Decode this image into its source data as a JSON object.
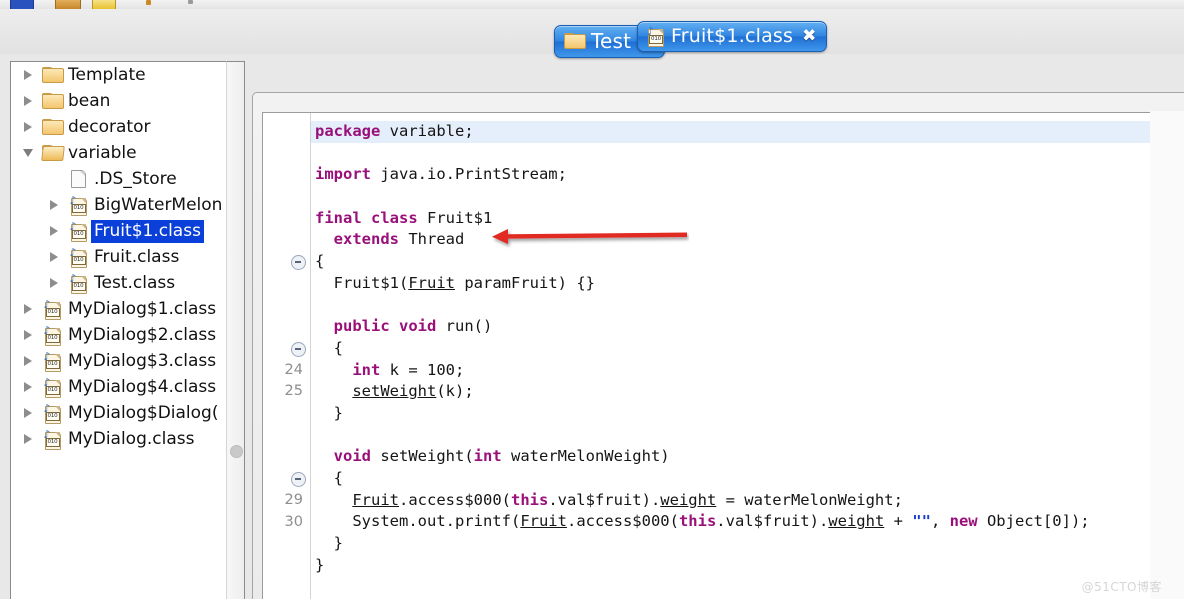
{
  "toolbar": {
    "icons": [
      "blue-button-icon",
      "folder-icon",
      "open-folder-icon",
      "small-dot-icon",
      "small-grey-dot-icon"
    ]
  },
  "project_tabs": [
    {
      "label": "Test",
      "icon": "folder-icon",
      "close_label": "✖",
      "active": true
    }
  ],
  "editor_tabs": [
    {
      "label": "Fruit$1.class",
      "icon": "class-file-icon",
      "close_label": "✖",
      "active": true
    }
  ],
  "sidebar": {
    "items": [
      {
        "label": "Template",
        "icon": "folder-icon",
        "twisty": "right",
        "indent": 0,
        "selected": false
      },
      {
        "label": "bean",
        "icon": "folder-icon",
        "twisty": "right",
        "indent": 0,
        "selected": false
      },
      {
        "label": "decorator",
        "icon": "folder-icon",
        "twisty": "right",
        "indent": 0,
        "selected": false
      },
      {
        "label": "variable",
        "icon": "open-folder-icon",
        "twisty": "down",
        "indent": 0,
        "selected": false
      },
      {
        "label": ".DS_Store",
        "icon": "document-icon",
        "twisty": "none",
        "indent": 1,
        "selected": false
      },
      {
        "label": "BigWaterMelon",
        "icon": "class-file-icon",
        "twisty": "right",
        "indent": 1,
        "selected": false
      },
      {
        "label": "Fruit$1.class",
        "icon": "class-file-icon",
        "twisty": "right",
        "indent": 1,
        "selected": true
      },
      {
        "label": "Fruit.class",
        "icon": "class-file-icon",
        "twisty": "right",
        "indent": 1,
        "selected": false
      },
      {
        "label": "Test.class",
        "icon": "class-file-icon",
        "twisty": "right",
        "indent": 1,
        "selected": false
      },
      {
        "label": "MyDialog$1.class",
        "icon": "class-file-icon",
        "twisty": "right",
        "indent": 0,
        "selected": false
      },
      {
        "label": "MyDialog$2.class",
        "icon": "class-file-icon",
        "twisty": "right",
        "indent": 0,
        "selected": false
      },
      {
        "label": "MyDialog$3.class",
        "icon": "class-file-icon",
        "twisty": "right",
        "indent": 0,
        "selected": false
      },
      {
        "label": "MyDialog$4.class",
        "icon": "class-file-icon",
        "twisty": "right",
        "indent": 0,
        "selected": false
      },
      {
        "label": "MyDialog$Dialog(",
        "icon": "class-file-icon",
        "twisty": "right",
        "indent": 0,
        "selected": false
      },
      {
        "label": "MyDialog.class",
        "icon": "class-file-icon",
        "twisty": "right",
        "indent": 0,
        "selected": false
      }
    ],
    "scrollbar_grip": "scrollbar-grip"
  },
  "editor": {
    "language": "java",
    "lines": [
      {
        "num": "",
        "fold": false,
        "highlight": true,
        "tokens": [
          {
            "t": "package",
            "c": "kw"
          },
          {
            "t": " variable;",
            "c": ""
          }
        ]
      },
      {
        "num": "",
        "fold": false,
        "highlight": false,
        "tokens": []
      },
      {
        "num": "",
        "fold": false,
        "highlight": false,
        "tokens": [
          {
            "t": "import",
            "c": "kw"
          },
          {
            "t": " java.io.PrintStream;",
            "c": ""
          }
        ]
      },
      {
        "num": "",
        "fold": false,
        "highlight": false,
        "tokens": []
      },
      {
        "num": "",
        "fold": false,
        "highlight": false,
        "tokens": [
          {
            "t": "final",
            "c": "kw"
          },
          {
            "t": " ",
            "c": ""
          },
          {
            "t": "class",
            "c": "kw"
          },
          {
            "t": " Fruit$1",
            "c": ""
          }
        ]
      },
      {
        "num": "",
        "fold": false,
        "highlight": false,
        "tokens": [
          {
            "t": "  ",
            "c": ""
          },
          {
            "t": "extends",
            "c": "kw"
          },
          {
            "t": " Thread",
            "c": ""
          }
        ]
      },
      {
        "num": "",
        "fold": true,
        "highlight": false,
        "tokens": [
          {
            "t": "{",
            "c": ""
          }
        ]
      },
      {
        "num": "",
        "fold": false,
        "highlight": false,
        "tokens": [
          {
            "t": "  Fruit$1(",
            "c": ""
          },
          {
            "t": "Fruit",
            "c": "ul"
          },
          {
            "t": " paramFruit) {}",
            "c": ""
          }
        ]
      },
      {
        "num": "",
        "fold": false,
        "highlight": false,
        "tokens": []
      },
      {
        "num": "",
        "fold": false,
        "highlight": false,
        "tokens": [
          {
            "t": "  ",
            "c": ""
          },
          {
            "t": "public",
            "c": "kw"
          },
          {
            "t": " ",
            "c": ""
          },
          {
            "t": "void",
            "c": "kw"
          },
          {
            "t": " run()",
            "c": ""
          }
        ]
      },
      {
        "num": "",
        "fold": true,
        "highlight": false,
        "tokens": [
          {
            "t": "  {",
            "c": ""
          }
        ]
      },
      {
        "num": "24",
        "fold": false,
        "highlight": false,
        "tokens": [
          {
            "t": "    ",
            "c": ""
          },
          {
            "t": "int",
            "c": "kw"
          },
          {
            "t": " k = ",
            "c": ""
          },
          {
            "t": "100",
            "c": ""
          },
          {
            "t": ";",
            "c": ""
          }
        ]
      },
      {
        "num": "25",
        "fold": false,
        "highlight": false,
        "tokens": [
          {
            "t": "    ",
            "c": ""
          },
          {
            "t": "setWeight",
            "c": "ul"
          },
          {
            "t": "(k);",
            "c": ""
          }
        ]
      },
      {
        "num": "",
        "fold": false,
        "highlight": false,
        "tokens": [
          {
            "t": "  }",
            "c": ""
          }
        ]
      },
      {
        "num": "",
        "fold": false,
        "highlight": false,
        "tokens": []
      },
      {
        "num": "",
        "fold": false,
        "highlight": false,
        "tokens": [
          {
            "t": "  ",
            "c": ""
          },
          {
            "t": "void",
            "c": "kw"
          },
          {
            "t": " setWeight(",
            "c": ""
          },
          {
            "t": "int",
            "c": "kw"
          },
          {
            "t": " waterMelonWeight)",
            "c": ""
          }
        ]
      },
      {
        "num": "",
        "fold": true,
        "highlight": false,
        "tokens": [
          {
            "t": "  {",
            "c": ""
          }
        ]
      },
      {
        "num": "29",
        "fold": false,
        "highlight": false,
        "tokens": [
          {
            "t": "    ",
            "c": ""
          },
          {
            "t": "Fruit",
            "c": "ul"
          },
          {
            "t": ".access$000(",
            "c": ""
          },
          {
            "t": "this",
            "c": "kw"
          },
          {
            "t": ".val$fruit).",
            "c": ""
          },
          {
            "t": "weight",
            "c": "ul"
          },
          {
            "t": " = waterMelonWeight;",
            "c": ""
          }
        ]
      },
      {
        "num": "30",
        "fold": false,
        "highlight": false,
        "tokens": [
          {
            "t": "    System.out.printf(",
            "c": ""
          },
          {
            "t": "Fruit",
            "c": "ul"
          },
          {
            "t": ".access$000(",
            "c": ""
          },
          {
            "t": "this",
            "c": "kw"
          },
          {
            "t": ".val$fruit).",
            "c": ""
          },
          {
            "t": "weight",
            "c": "ul"
          },
          {
            "t": " + ",
            "c": ""
          },
          {
            "t": "\"\"",
            "c": "str"
          },
          {
            "t": ", ",
            "c": ""
          },
          {
            "t": "new",
            "c": "kw"
          },
          {
            "t": " Object[",
            "c": ""
          },
          {
            "t": "0",
            "c": ""
          },
          {
            "t": "]);",
            "c": ""
          }
        ]
      },
      {
        "num": "",
        "fold": false,
        "highlight": false,
        "tokens": [
          {
            "t": "  }",
            "c": ""
          }
        ]
      },
      {
        "num": "",
        "fold": false,
        "highlight": false,
        "tokens": [
          {
            "t": "}",
            "c": ""
          }
        ]
      }
    ]
  },
  "annotation": {
    "type": "arrow-left",
    "color": "#e02b20",
    "target": "extends Thread"
  },
  "watermark": {
    "text": "@51CTO博客"
  },
  "colors": {
    "selection_blue": "#0b3fd9",
    "tab_blue": "#2e84e0",
    "keyword_purple": "#99107a",
    "string_blue": "#1a3fd0",
    "line_highlight": "#e5eefb",
    "gutter_number": "#8e8e8e",
    "annotation_red": "#e02b20"
  }
}
